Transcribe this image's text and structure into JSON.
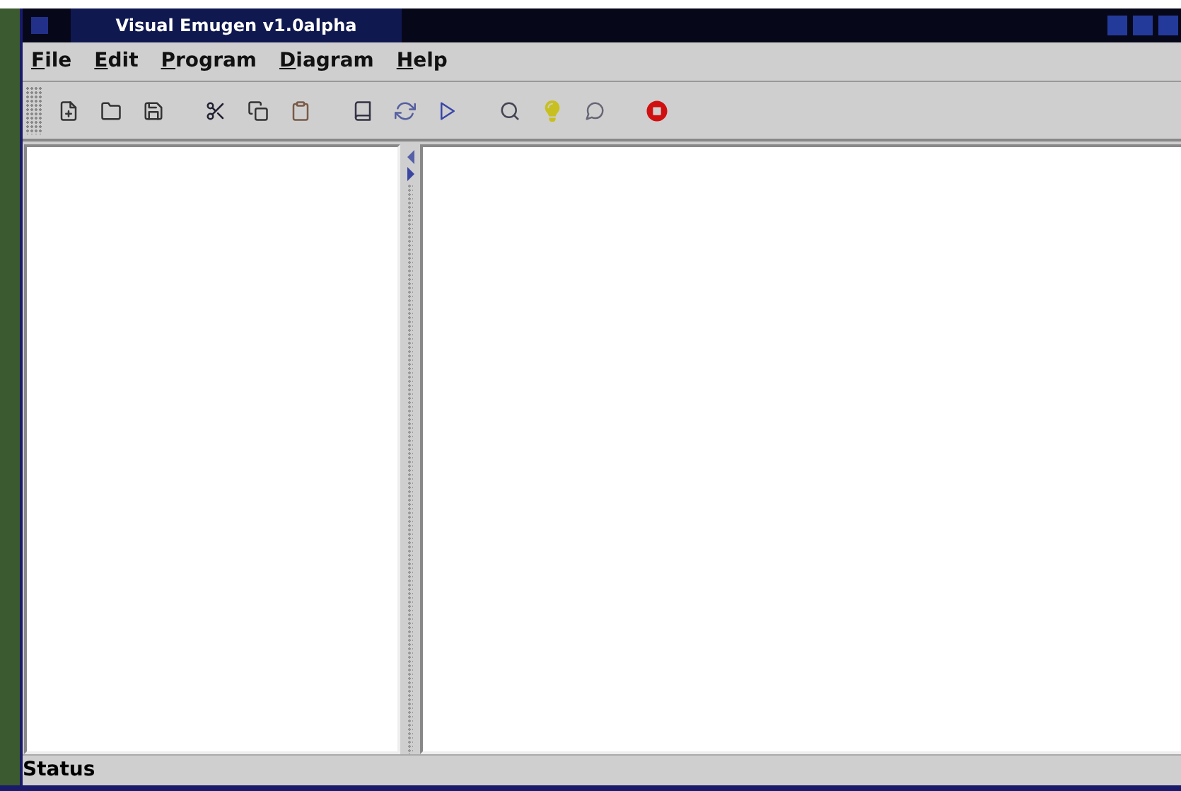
{
  "window": {
    "title": "Visual Emugen v1.0alpha"
  },
  "menu": [
    "File",
    "Edit",
    "Program",
    "Diagram",
    "Help"
  ],
  "status_bar": "Status"
}
